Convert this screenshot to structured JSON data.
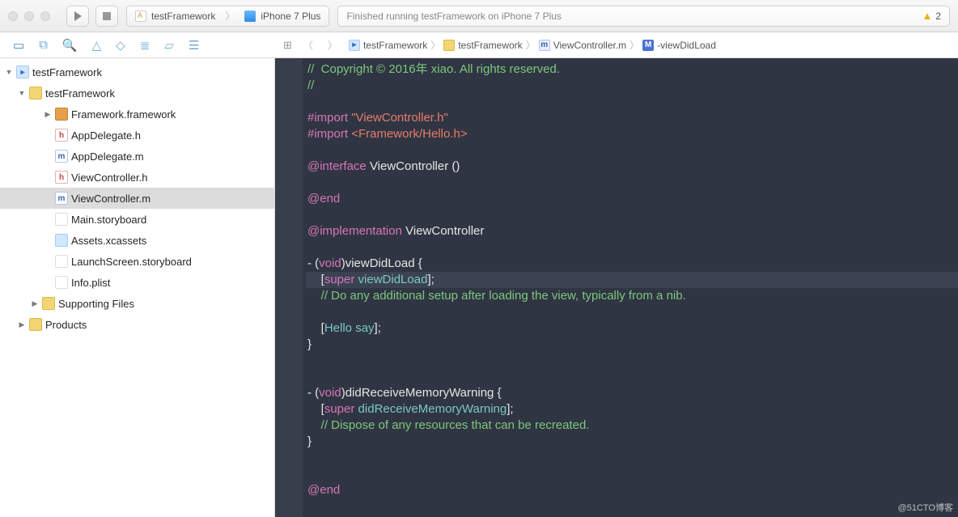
{
  "toolbar": {
    "scheme_target": "testFramework",
    "scheme_device": "iPhone 7 Plus",
    "activity_text": "Finished running testFramework on iPhone 7 Plus",
    "warning_count": "2"
  },
  "jumpbar": {
    "project": "testFramework",
    "folder": "testFramework",
    "file": "ViewController.m",
    "symbol": "-viewDidLoad"
  },
  "tree": {
    "root": "testFramework",
    "group": "testFramework",
    "items": [
      {
        "label": "Framework.framework",
        "icon": "brief",
        "disc": "closed",
        "indent": 3
      },
      {
        "label": "AppDelegate.h",
        "icon": "h",
        "disc": "none",
        "indent": 3
      },
      {
        "label": "AppDelegate.m",
        "icon": "m",
        "disc": "none",
        "indent": 3
      },
      {
        "label": "ViewController.h",
        "icon": "h",
        "disc": "none",
        "indent": 3
      },
      {
        "label": "ViewController.m",
        "icon": "m",
        "disc": "none",
        "indent": 3,
        "selected": true
      },
      {
        "label": "Main.storyboard",
        "icon": "sb",
        "disc": "none",
        "indent": 3
      },
      {
        "label": "Assets.xcassets",
        "icon": "xc",
        "disc": "none",
        "indent": 3
      },
      {
        "label": "LaunchScreen.storyboard",
        "icon": "sb",
        "disc": "none",
        "indent": 3
      },
      {
        "label": "Info.plist",
        "icon": "pl",
        "disc": "none",
        "indent": 3
      },
      {
        "label": "Supporting Files",
        "icon": "folder",
        "disc": "closed",
        "indent": 2
      },
      {
        "label": "Products",
        "icon": "folder",
        "disc": "closed",
        "indent": 1
      }
    ]
  },
  "code": {
    "lines": [
      {
        "t": "cmt",
        "s": "//  Copyright © 2016年 xiao. All rights reserved."
      },
      {
        "t": "cmt",
        "s": "//"
      },
      {
        "t": "blank",
        "s": ""
      },
      {
        "t": "import1",
        "pp": "#import ",
        "str": "\"ViewController.h\""
      },
      {
        "t": "import1",
        "pp": "#import ",
        "str": "<Framework/Hello.h>"
      },
      {
        "t": "blank",
        "s": ""
      },
      {
        "t": "iface",
        "at": "@interface ",
        "id": "ViewController ()"
      },
      {
        "t": "blank",
        "s": ""
      },
      {
        "t": "at",
        "s": "@end"
      },
      {
        "t": "blank",
        "s": ""
      },
      {
        "t": "impl",
        "at": "@implementation ",
        "id": "ViewController"
      },
      {
        "t": "blank",
        "s": ""
      },
      {
        "t": "sig",
        "dash": "- (",
        "kw": "void",
        "rest": ")viewDidLoad {"
      },
      {
        "t": "super",
        "open": "    [",
        "sup": "super ",
        "call": "viewDidLoad",
        "close": "];",
        "hl": true
      },
      {
        "t": "cmt",
        "s": "    // Do any additional setup after loading the view, typically from a nib."
      },
      {
        "t": "blank",
        "s": "    "
      },
      {
        "t": "hello",
        "open": "    [",
        "call": "Hello say",
        "close": "];"
      },
      {
        "t": "plain",
        "s": "}"
      },
      {
        "t": "blank",
        "s": ""
      },
      {
        "t": "blank",
        "s": ""
      },
      {
        "t": "sig",
        "dash": "- (",
        "kw": "void",
        "rest": ")didReceiveMemoryWarning {"
      },
      {
        "t": "super",
        "open": "    [",
        "sup": "super ",
        "call": "didReceiveMemoryWarning",
        "close": "];"
      },
      {
        "t": "cmt",
        "s": "    // Dispose of any resources that can be recreated."
      },
      {
        "t": "plain",
        "s": "}"
      },
      {
        "t": "blank",
        "s": ""
      },
      {
        "t": "blank",
        "s": ""
      },
      {
        "t": "at",
        "s": "@end"
      }
    ]
  },
  "watermark": "@51CTO博客"
}
